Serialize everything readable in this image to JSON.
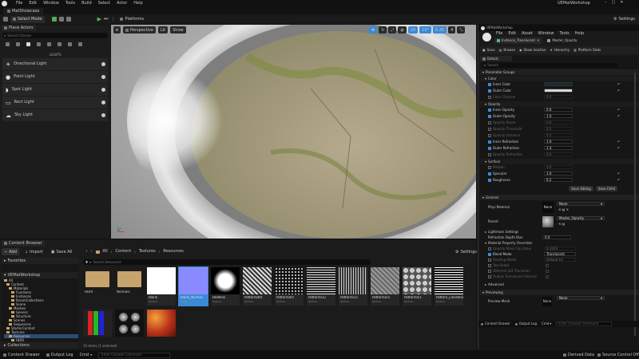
{
  "window": {
    "project": "UEMatWorkshop",
    "tab": "MatShowcase",
    "menu": [
      "File",
      "Edit",
      "Window",
      "Tools",
      "Build",
      "Select",
      "Actor",
      "Help"
    ]
  },
  "toolbar": {
    "select_mode": "Select Mode",
    "platforms": "Platforms",
    "settings": "Settings"
  },
  "place_actors": {
    "tab": "Place Actors",
    "search_placeholder": "Search Classes",
    "category": "LIGHTS",
    "items": [
      "Directional Light",
      "Point Light",
      "Spot Light",
      "Rect Light",
      "Sky Light"
    ]
  },
  "viewport": {
    "perspective": "Perspective",
    "lit": "Lit",
    "show": "Show",
    "snap_grid": "10",
    "snap_angle": "10°",
    "scale": "0.25",
    "cam_speed": "4"
  },
  "content_browser": {
    "tab": "Content Browser",
    "add": "Add",
    "import": "Import",
    "save_all": "Save All",
    "crumbs": [
      "All",
      "Content",
      "Textures",
      "Resources"
    ],
    "search_placeholder": "Search Resources",
    "settings": "Settings",
    "favorites": "Favorites",
    "project": "UEMatWorkshop",
    "folders": [
      "All",
      "Content",
      "Materials",
      "Functions",
      "Instances",
      "ParamCollections",
      "Scene",
      "Meshes",
      "Generic",
      "Structure",
      "Scenes",
      "Sequences",
      "StarterContent",
      "Textures",
      "Resources",
      "HDRI",
      "Normals"
    ],
    "assets_row1": [
      "HDRI",
      "Normals",
      "Blank",
      "Blank_Normal",
      "Heldesk",
      "Pattern000",
      "Pattern005",
      "Pattern012",
      "Pattern015",
      "Pattern025",
      "Pattern051",
      "Pattern_Lines002"
    ],
    "asset_type": "Texture",
    "status": "15 items (1 selected)",
    "collections": "Collections"
  },
  "bottom_bar": {
    "content_drawer": "Content Drawer",
    "output_log": "Output Log",
    "cmd": "Cmd",
    "console_placeholder": "Enter Console Command",
    "derived_data": "Derived Data",
    "source_control": "Source Control Off"
  },
  "material_editor": {
    "title": "UEMatWorkshop",
    "menu": [
      "File",
      "Edit",
      "Asset",
      "Window",
      "Tools",
      "Help"
    ],
    "tab_instance": "Instance_Translucent",
    "tab_master": "Master_Opacity",
    "toolbar": [
      "Save",
      "Browse",
      "Show Inactive",
      "Hierarchy",
      "Platform Stats"
    ],
    "details_tab": "Details",
    "search_placeholder": "Search",
    "parameter_groups": "Parameter Groups",
    "groups": {
      "color": {
        "label": "Color",
        "params": [
          {
            "name": "Inner Color",
            "value": "",
            "on": true
          },
          {
            "name": "Outer Color",
            "value": "",
            "on": true
          },
          {
            "name": "Color Channel",
            "value": "0.0",
            "on": false
          }
        ]
      },
      "opacity": {
        "label": "Opacity",
        "params": [
          {
            "name": "Inner Opacity",
            "value": "0.6",
            "on": true
          },
          {
            "name": "Outer Opacity",
            "value": "1.0",
            "on": true
          },
          {
            "name": "Opacity Power",
            "value": "0.0",
            "on": false
          },
          {
            "name": "Opacity Threshold",
            "value": "0.5",
            "on": false
          },
          {
            "name": "Opacity Variance",
            "value": "0.5",
            "on": false
          },
          {
            "name": "Inner Refraction",
            "value": "1.0",
            "on": true
          },
          {
            "name": "Outer Refraction",
            "value": "1.4",
            "on": true
          },
          {
            "name": "Opacity Refraction",
            "value": "0.0",
            "on": false
          }
        ]
      },
      "surface": {
        "label": "Surface",
        "params": [
          {
            "name": "Metallic",
            "value": "0.0",
            "on": false
          },
          {
            "name": "Specular",
            "value": "1.0",
            "on": true
          },
          {
            "name": "Roughness",
            "value": "0.2",
            "on": true
          }
        ]
      }
    },
    "save_sibling": "Save Sibling",
    "save_child": "Save Child",
    "general": "General",
    "phys_material": "Phys Material",
    "phys_value": "None",
    "none_label": "None",
    "parent_label": "Parent",
    "parent_value": "Master_Opacity",
    "lightmass": "Lightmass Settings",
    "refraction_depth": "Refraction Depth Bias",
    "refraction_value": "0.0",
    "overrides": "Material Property Overrides",
    "override_rows": [
      {
        "name": "Opacity Mask Clip Value",
        "value": "0.3333"
      },
      {
        "name": "Blend Mode",
        "value": "Translucent"
      },
      {
        "name": "Shading Model",
        "value": "Default Lit"
      },
      {
        "name": "Two Sided",
        "value": ""
      },
      {
        "name": "Dithered LOF Transition",
        "value": ""
      },
      {
        "name": "Output Translucent Velocity",
        "value": ""
      }
    ],
    "advanced": "Advanced",
    "previewing": "Previewing",
    "preview_mesh": "Preview Mesh",
    "preview_value": "None",
    "bottom": [
      "Content Drawer",
      "Output Log",
      "Cmd"
    ],
    "console_placeholder": "Enter Console Command"
  },
  "colors": {
    "accent": "#3a8ad6",
    "panel": "#1f1f1f",
    "dark": "#121212",
    "folder": "#c7a46b"
  }
}
